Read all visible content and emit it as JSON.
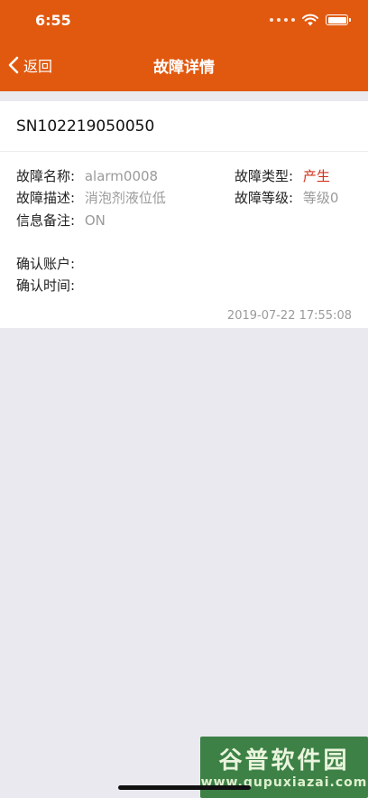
{
  "status_bar": {
    "time": "6:55"
  },
  "nav": {
    "back_label": "返回",
    "title": "故障详情"
  },
  "detail": {
    "serial": "SN102219050050",
    "fault_name": {
      "label": "故障名称:",
      "value": "alarm0008"
    },
    "fault_type": {
      "label": "故障类型:",
      "value": "产生"
    },
    "fault_desc": {
      "label": "故障描述:",
      "value": "消泡剂液位低"
    },
    "fault_level": {
      "label": "故障等级:",
      "value": "等级0"
    },
    "info_note": {
      "label": "信息备注:",
      "value": "ON"
    },
    "confirm_account": {
      "label": "确认账户:",
      "value": ""
    },
    "confirm_time": {
      "label": "确认时间:",
      "value": ""
    },
    "timestamp": "2019-07-22 17:55:08"
  },
  "watermark": {
    "main": "谷普软件园",
    "sub": "www.gupuxiazai.com"
  },
  "colors": {
    "accent": "#e1590f",
    "value_red": "#d0311a",
    "background": "#eae9ef"
  }
}
